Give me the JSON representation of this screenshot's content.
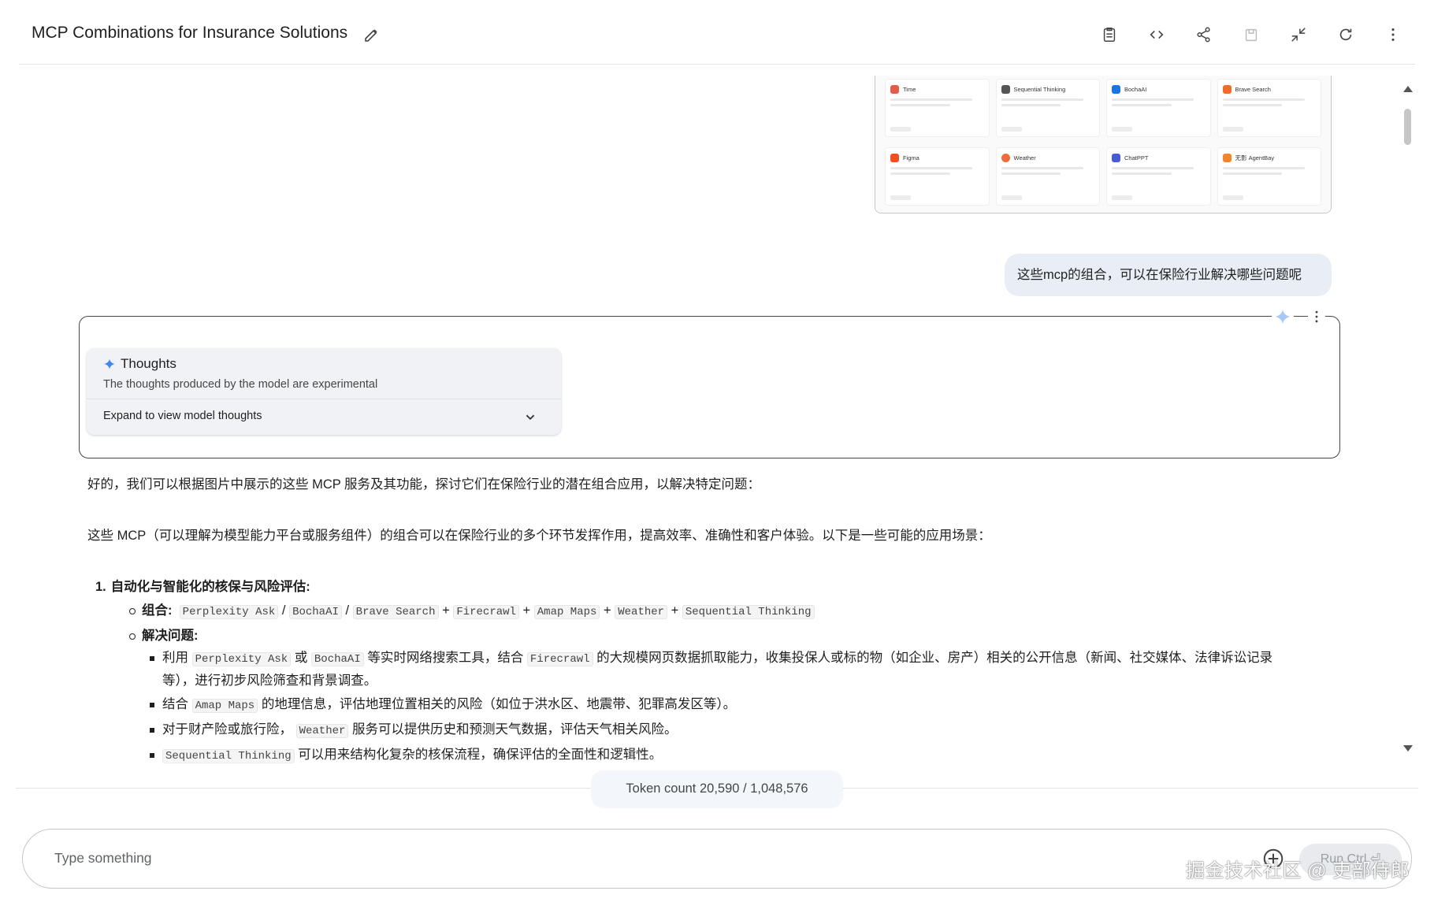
{
  "header": {
    "title": "MCP Combinations for Insurance Solutions",
    "edit_icon": "pencil-icon",
    "toolbar_icons": [
      "clipboard-icon",
      "code-icon",
      "share-icon",
      "save-drive-icon",
      "collapse-icon",
      "refresh-icon",
      "more-vert-icon"
    ]
  },
  "image_preview": {
    "tiles": [
      {
        "name": "Time",
        "color": "#e25c4a"
      },
      {
        "name": "Sequential Thinking",
        "color": "#555555"
      },
      {
        "name": "BochaAI",
        "color": "#1a73e8"
      },
      {
        "name": "Brave Search",
        "color": "#f26b2a"
      },
      {
        "name": "Figma",
        "color": "#f24e1e"
      },
      {
        "name": "Weather",
        "color": "#ef6c3c"
      },
      {
        "name": "ChatPPT",
        "color": "#4a5bd8"
      },
      {
        "name": "无影 AgentBay",
        "color": "#f2842a"
      }
    ]
  },
  "user_message": "这些mcp的组合，可以在保险行业解决哪些问题呢",
  "thoughts": {
    "title": "Thoughts",
    "subtitle": "The thoughts produced by the model are experimental",
    "expand_label": "Expand to view model thoughts"
  },
  "response": {
    "intro1": "好的，我们可以根据图片中展示的这些 MCP 服务及其功能，探讨它们在保险行业的潜在组合应用，以解决特定问题：",
    "intro2": "这些 MCP（可以理解为模型能力平台或服务组件）的组合可以在保险行业的多个环节发挥作用，提高效率、准确性和客户体验。以下是一些可能的应用场景：",
    "item1": {
      "number": "1.",
      "heading": "自动化与智能化的核保与风险评估:",
      "combo_label": "组合:",
      "combo": {
        "c1": "Perplexity Ask",
        "sep1": "/",
        "c2": "BochaAI",
        "sep2": "/",
        "c3": "Brave Search",
        "plus1": "+",
        "c4": "Firecrawl",
        "plus2": "+",
        "c5": "Amap Maps",
        "plus3": "+",
        "c6": "Weather",
        "plus4": "+",
        "c7": "Sequential Thinking"
      },
      "solve_label": "解决问题:",
      "bullets": {
        "b1": {
          "t1": "利用",
          "code1": "Perplexity Ask",
          "t2": "或",
          "code2": "BochaAI",
          "t3": "等实时网络搜索工具，结合",
          "code3": "Firecrawl",
          "t4": "的大规模网页数据抓取能力，收集投保人或标的物（如企业、房产）相关的公开信息（新闻、社交媒体、法律诉讼记录",
          "t5": "等），进行初步风险筛查和背景调查。"
        },
        "b2": {
          "t1": "结合",
          "code1": "Amap Maps",
          "t2": "的地理信息，评估地理位置相关的风险（如位于洪水区、地震带、犯罪高发区等）。"
        },
        "b3": {
          "t1": "对于财产险或旅行险，",
          "code1": "Weather",
          "t2": "服务可以提供历史和预测天气数据，评估天气相关风险。"
        },
        "b4": {
          "code1": "Sequential Thinking",
          "t1": "可以用来结构化复杂的核保流程，确保评估的全面性和逻辑性。"
        }
      }
    }
  },
  "token_count": "Token count 20,590 / 1,048,576",
  "input": {
    "placeholder": "Type something",
    "run_label": "Run  Ctrl ⏎"
  },
  "watermark": "掘金技术社区 @ 吏部侍郎"
}
